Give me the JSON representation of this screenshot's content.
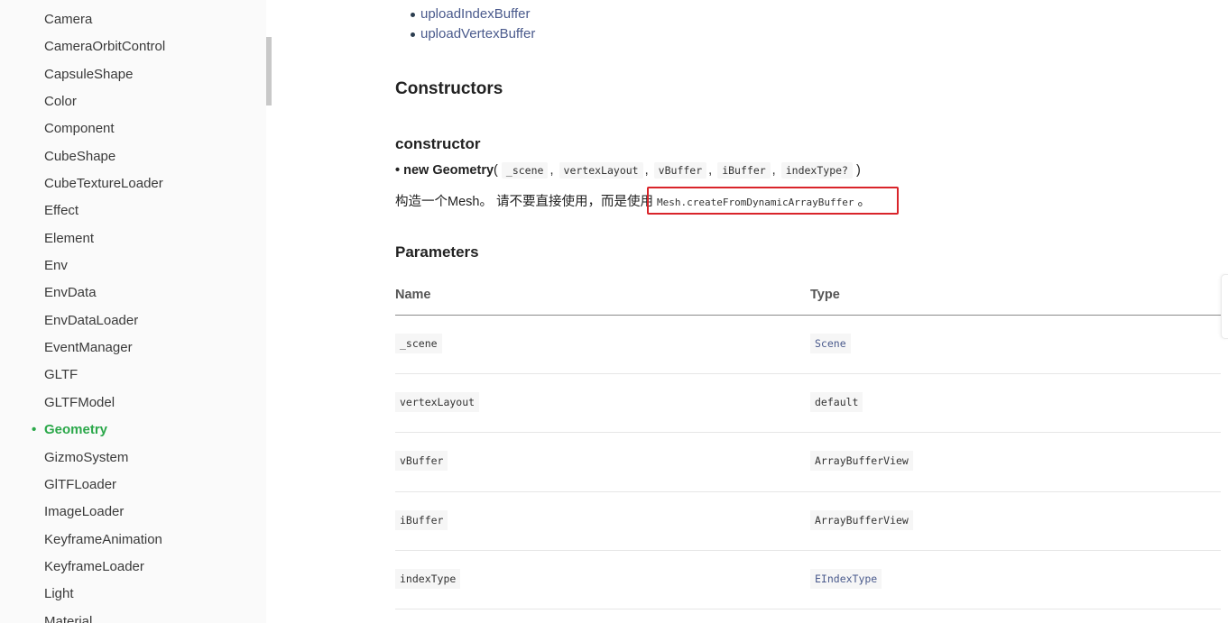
{
  "sidebar": {
    "items": [
      {
        "label": "Camera"
      },
      {
        "label": "CameraOrbitControl"
      },
      {
        "label": "CapsuleShape"
      },
      {
        "label": "Color"
      },
      {
        "label": "Component"
      },
      {
        "label": "CubeShape"
      },
      {
        "label": "CubeTextureLoader"
      },
      {
        "label": "Effect"
      },
      {
        "label": "Element"
      },
      {
        "label": "Env"
      },
      {
        "label": "EnvData"
      },
      {
        "label": "EnvDataLoader"
      },
      {
        "label": "EventManager"
      },
      {
        "label": "GLTF"
      },
      {
        "label": "GLTFModel"
      },
      {
        "label": "Geometry",
        "active": true
      },
      {
        "label": "GizmoSystem"
      },
      {
        "label": "GlTFLoader"
      },
      {
        "label": "ImageLoader"
      },
      {
        "label": "KeyframeAnimation"
      },
      {
        "label": "KeyframeLoader"
      },
      {
        "label": "Light"
      },
      {
        "label": "Material"
      }
    ],
    "active_bullet": "•"
  },
  "methods": [
    "uploadIndexBuffer",
    "uploadVertexBuffer"
  ],
  "constructors": {
    "heading": "Constructors",
    "name": "constructor",
    "signature": {
      "bullet": "•",
      "new_label": "new Geometry",
      "open": "(",
      "close": ")",
      "params": [
        "_scene",
        "vertexLayout",
        "vBuffer",
        "iBuffer",
        "indexType?"
      ],
      "separator": ","
    },
    "description": {
      "text": "构造一个Mesh。 请不要直接使用，而是使用",
      "code": "Mesh.createFromDynamicArrayBuffer",
      "suffix": "。"
    }
  },
  "parameters": {
    "heading": "Parameters",
    "columns": {
      "name": "Name",
      "type": "Type"
    },
    "rows": [
      {
        "name": "_scene",
        "type": "Scene",
        "type_is_link": true
      },
      {
        "name": "vertexLayout",
        "type": "default",
        "type_is_link": false
      },
      {
        "name": "vBuffer",
        "type": "ArrayBufferView",
        "type_is_link": false
      },
      {
        "name": "iBuffer",
        "type": "ArrayBufferView",
        "type_is_link": false
      },
      {
        "name": "indexType",
        "type": "EIndexType",
        "type_is_link": true
      }
    ]
  },
  "colors": {
    "active": "#2ba84a",
    "link": "#4a5a8c",
    "highlight": "#d9242a"
  }
}
